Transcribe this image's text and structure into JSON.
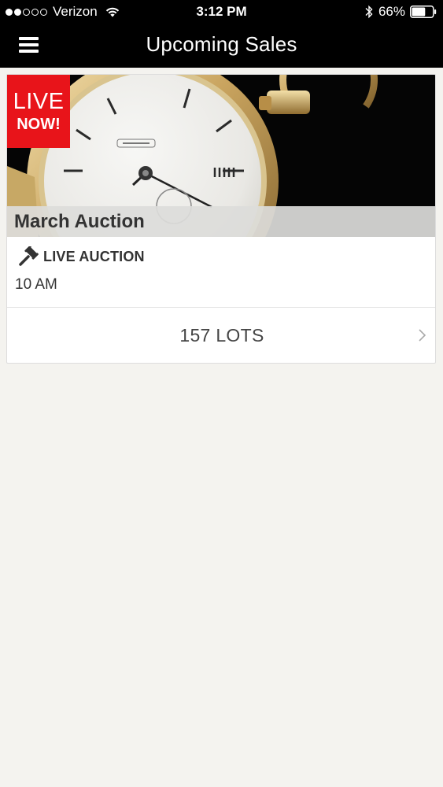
{
  "status_bar": {
    "carrier": "Verizon",
    "time": "3:12 PM",
    "battery": "66%",
    "signal_bars_filled": 2,
    "signal_bars_total": 5,
    "battery_level": 0.66
  },
  "nav": {
    "title": "Upcoming Sales"
  },
  "sale": {
    "badge_line1": "LIVE",
    "badge_line2": "NOW!",
    "title": "March Auction",
    "auction_type": "LIVE AUCTION",
    "time": "10 AM",
    "lots": "157 LOTS"
  },
  "colors": {
    "badge": "#e8141a",
    "bars": "#000000",
    "background": "#f4f3ef"
  }
}
